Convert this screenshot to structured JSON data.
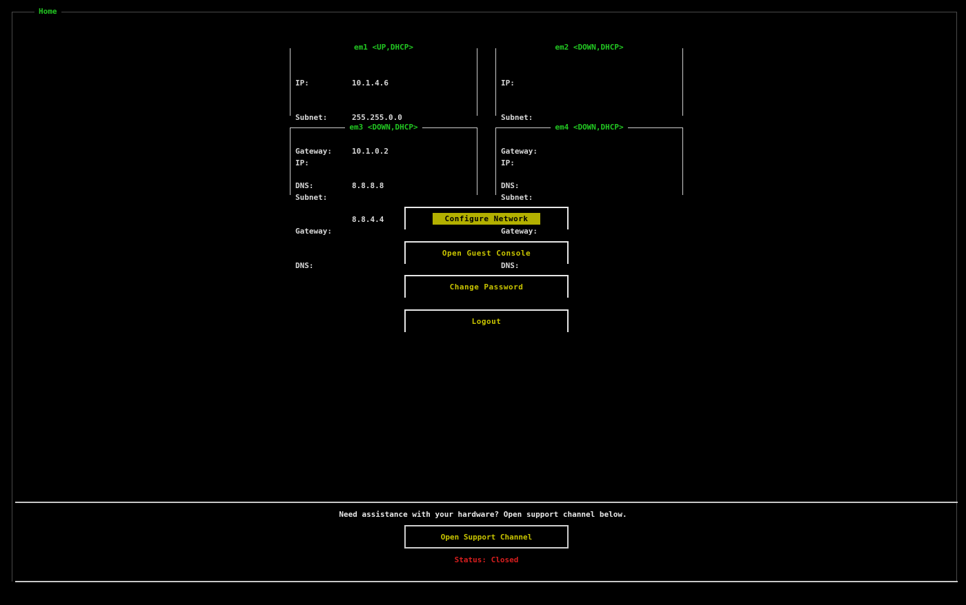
{
  "window": {
    "title": "Home"
  },
  "interfaces": [
    {
      "title": "em1 <UP,DHCP>",
      "ip_label": "IP:",
      "ip": "10.1.4.6",
      "subnet_label": "Subnet:",
      "subnet": "255.255.0.0",
      "gateway_label": "Gateway:",
      "gateway": "10.1.0.2",
      "dns_label": "DNS:",
      "dns": [
        "8.8.8.8",
        "8.8.4.4"
      ]
    },
    {
      "title": "em2 <DOWN,DHCP>",
      "ip_label": "IP:",
      "ip": "",
      "subnet_label": "Subnet:",
      "subnet": "",
      "gateway_label": "Gateway:",
      "gateway": "",
      "dns_label": "DNS:",
      "dns": [
        "",
        ""
      ]
    },
    {
      "title": "em3 <DOWN,DHCP>",
      "ip_label": "IP:",
      "ip": "",
      "subnet_label": "Subnet:",
      "subnet": "",
      "gateway_label": "Gateway:",
      "gateway": "",
      "dns_label": "DNS:",
      "dns": [
        "",
        ""
      ]
    },
    {
      "title": "em4 <DOWN,DHCP>",
      "ip_label": "IP:",
      "ip": "",
      "subnet_label": "Subnet:",
      "subnet": "",
      "gateway_label": "Gateway:",
      "gateway": "",
      "dns_label": "DNS:",
      "dns": [
        "",
        ""
      ]
    }
  ],
  "menu": {
    "configure_network": "Configure Network",
    "open_guest_console": "Open Guest Console",
    "change_password": "Change Password",
    "logout": "Logout"
  },
  "support": {
    "message": "Need assistance with your hardware? Open support channel below.",
    "button_label": "Open Support Channel",
    "status": "Status: Closed"
  },
  "colors": {
    "background": "#000000",
    "title_green": "#22c722",
    "button_yellow": "#c8c400",
    "focus_highlight": "#b3b000",
    "status_red": "#d81e1e"
  }
}
